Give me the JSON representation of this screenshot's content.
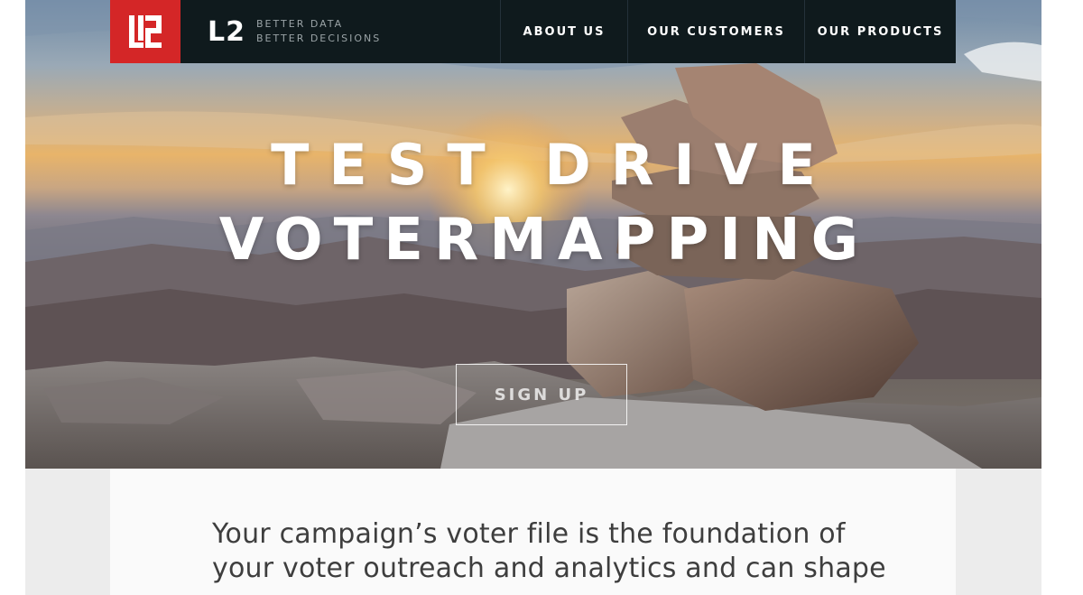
{
  "nav": {
    "logo_icon": "l2-logo-mark",
    "brand_name": "L2",
    "tagline_line1": "BETTER DATA",
    "tagline_line2": "BETTER DECISIONS",
    "links": [
      {
        "label": "ABOUT US"
      },
      {
        "label": "OUR CUSTOMERS"
      },
      {
        "label": "OUR PRODUCTS"
      }
    ]
  },
  "hero": {
    "headline_line1": "TEST DRIVE",
    "headline_line2": "VOTERMAPPING",
    "cta_label": "SIGN UP"
  },
  "content": {
    "intro_text": "Your campaign’s voter file is the foundation of your voter outreach and analytics and can shape every"
  },
  "colors": {
    "brand_red": "#d42627",
    "nav_background": "#0f1a1d",
    "body_text": "#3e3e3e"
  }
}
